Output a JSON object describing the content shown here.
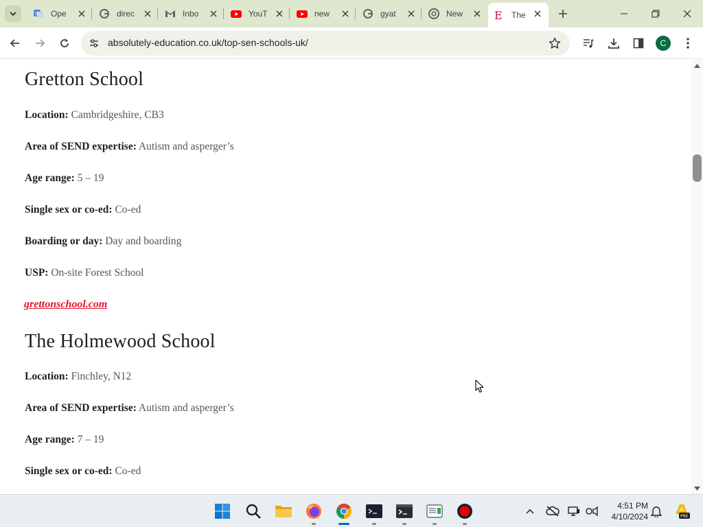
{
  "browser": {
    "tabs": [
      {
        "title": "Ope",
        "favicon": "translate-icon",
        "active": false
      },
      {
        "title": "direc",
        "favicon": "google-icon",
        "active": false
      },
      {
        "title": "Inbo",
        "favicon": "gmail-icon",
        "active": false
      },
      {
        "title": "YouT",
        "favicon": "youtube-icon",
        "active": false
      },
      {
        "title": "new",
        "favicon": "youtube-icon",
        "active": false
      },
      {
        "title": "gyat",
        "favicon": "google-icon",
        "active": false
      },
      {
        "title": "New",
        "favicon": "chrome-icon",
        "active": false
      },
      {
        "title": "The",
        "favicon": "site-e-icon",
        "active": true
      }
    ],
    "url": "absolutely-education.co.uk/top-sen-schools-uk/",
    "profile_initial": "C"
  },
  "article": {
    "schools": [
      {
        "name": "Gretton School",
        "fields": [
          {
            "label": "Location:",
            "value": "Cambridgeshire, CB3"
          },
          {
            "label": "Area of SEND expertise:",
            "value": "Autism and asperger’s"
          },
          {
            "label": "Age range:",
            "value": "5 – 19"
          },
          {
            "label": "Single sex or co-ed:",
            "value": "Co-ed"
          },
          {
            "label": "Boarding or day:",
            "value": "Day and boarding"
          },
          {
            "label": "USP:",
            "value": "On-site Forest School"
          }
        ],
        "link": "grettonschool.com"
      },
      {
        "name": "The Holmewood School",
        "fields": [
          {
            "label": "Location:",
            "value": "Finchley, N12"
          },
          {
            "label": "Area of SEND expertise:",
            "value": "Autism and asperger’s"
          },
          {
            "label": "Age range:",
            "value": "7 – 19"
          },
          {
            "label": "Single sex or co-ed:",
            "value": "Co-ed"
          }
        ]
      }
    ]
  },
  "taskbar": {
    "apps": [
      "windows-start-icon",
      "search-icon",
      "file-explorer-icon",
      "firefox-icon",
      "chrome-icon",
      "terminal-dark-icon",
      "terminal-icon",
      "notepad-icon",
      "recorder-icon"
    ],
    "clock_time": "4:51 PM",
    "clock_date": "4/10/2024"
  },
  "colors": {
    "tabstrip_bg": "#dfe8cf",
    "link_red": "#e4162c",
    "taskbar_bg": "#e9eef3"
  }
}
